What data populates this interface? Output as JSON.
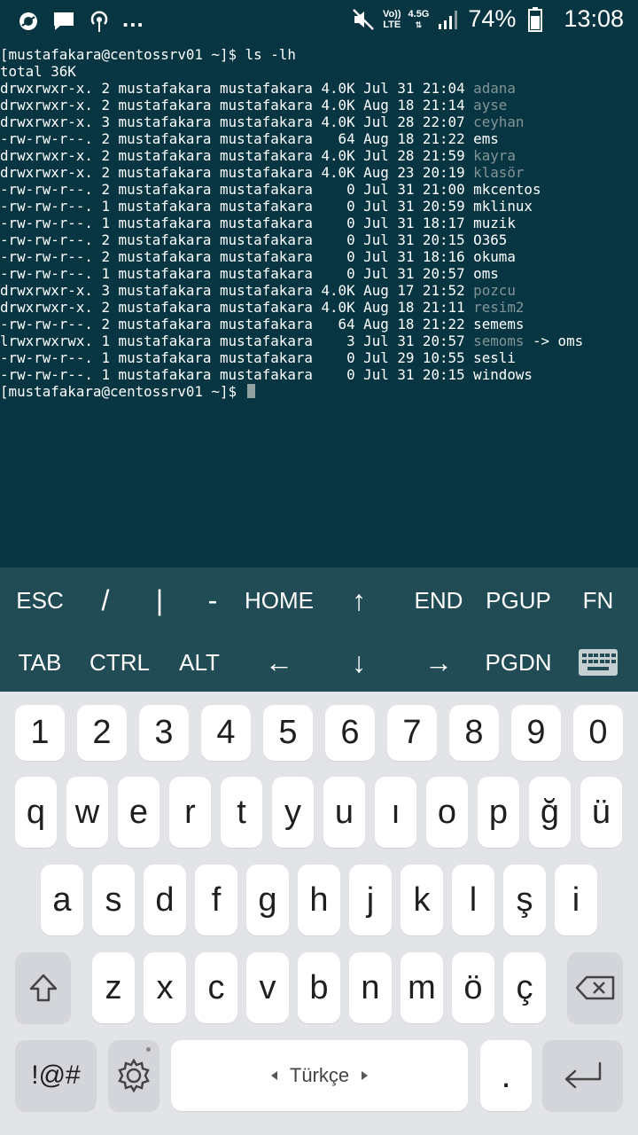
{
  "status_bar": {
    "left_icons": [
      "opera-icon",
      "message-icon",
      "hotspot-icon"
    ],
    "more": "...",
    "volte_top": "Vo))",
    "volte_bottom": "LTE",
    "network": "4.5G",
    "battery": "74%",
    "time": "13:08"
  },
  "terminal": {
    "prompt": "[mustafakara@centossrv01 ~]$ ",
    "command": "ls -lh",
    "total": "total 36K",
    "entries": [
      {
        "meta": "drwxrwxr-x. 2 mustafakara mustafakara 4.0K Jul 31 21:04 ",
        "name": "adana",
        "type": "dir"
      },
      {
        "meta": "drwxrwxr-x. 2 mustafakara mustafakara 4.0K Aug 18 21:14 ",
        "name": "ayse",
        "type": "dir"
      },
      {
        "meta": "drwxrwxr-x. 3 mustafakara mustafakara 4.0K Jul 28 22:07 ",
        "name": "ceyhan",
        "type": "dir"
      },
      {
        "meta": "-rw-rw-r--. 2 mustafakara mustafakara   64 Aug 18 21:22 ",
        "name": "ems",
        "type": "file"
      },
      {
        "meta": "drwxrwxr-x. 2 mustafakara mustafakara 4.0K Jul 28 21:59 ",
        "name": "kayra",
        "type": "dir"
      },
      {
        "meta": "drwxrwxr-x. 2 mustafakara mustafakara 4.0K Aug 23 20:19 ",
        "name": "klasör",
        "type": "dir"
      },
      {
        "meta": "-rw-rw-r--. 2 mustafakara mustafakara    0 Jul 31 21:00 ",
        "name": "mkcentos",
        "type": "file"
      },
      {
        "meta": "-rw-rw-r--. 1 mustafakara mustafakara    0 Jul 31 20:59 ",
        "name": "mklinux",
        "type": "file"
      },
      {
        "meta": "-rw-rw-r--. 1 mustafakara mustafakara    0 Jul 31 18:17 ",
        "name": "muzik",
        "type": "file"
      },
      {
        "meta": "-rw-rw-r--. 2 mustafakara mustafakara    0 Jul 31 20:15 ",
        "name": "O365",
        "type": "file"
      },
      {
        "meta": "-rw-rw-r--. 2 mustafakara mustafakara    0 Jul 31 18:16 ",
        "name": "okuma",
        "type": "file"
      },
      {
        "meta": "-rw-rw-r--. 1 mustafakara mustafakara    0 Jul 31 20:57 ",
        "name": "oms",
        "type": "file"
      },
      {
        "meta": "drwxrwxr-x. 3 mustafakara mustafakara 4.0K Aug 17 21:52 ",
        "name": "pozcu",
        "type": "dir"
      },
      {
        "meta": "drwxrwxr-x. 2 mustafakara mustafakara 4.0K Aug 18 21:11 ",
        "name": "resim2",
        "type": "dir"
      },
      {
        "meta": "-rw-rw-r--. 2 mustafakara mustafakara   64 Aug 18 21:22 ",
        "name": "semems",
        "type": "file"
      },
      {
        "meta": "lrwxrwxrwx. 1 mustafakara mustafakara    3 Jul 31 20:57 ",
        "name": "semoms",
        "type": "link",
        "target": " -> oms"
      },
      {
        "meta": "-rw-rw-r--. 1 mustafakara mustafakara    0 Jul 29 10:55 ",
        "name": "sesli",
        "type": "file"
      },
      {
        "meta": "-rw-rw-r--. 1 mustafakara mustafakara    0 Jul 31 20:15 ",
        "name": "windows",
        "type": "file"
      }
    ]
  },
  "extra_keys": {
    "row1": [
      "ESC",
      "/",
      "|",
      "-",
      "HOME",
      "↑",
      "END",
      "PGUP",
      "FN"
    ],
    "row2": [
      "TAB",
      "CTRL",
      "ALT",
      "←",
      "↓",
      "→",
      "PGDN"
    ],
    "keyboard_toggle_icon": "keyboard-icon"
  },
  "keyboard": {
    "digits": [
      "1",
      "2",
      "3",
      "4",
      "5",
      "6",
      "7",
      "8",
      "9",
      "0"
    ],
    "row_q": [
      "q",
      "w",
      "e",
      "r",
      "t",
      "y",
      "u",
      "ı",
      "o",
      "p",
      "ğ",
      "ü"
    ],
    "row_a": [
      "a",
      "s",
      "d",
      "f",
      "g",
      "h",
      "j",
      "k",
      "l",
      "ş",
      "i"
    ],
    "row_z": [
      "z",
      "x",
      "c",
      "v",
      "b",
      "n",
      "m",
      "ö",
      "ç"
    ],
    "symbols": "!@#",
    "space_label": "Türkçe",
    "period": "."
  }
}
